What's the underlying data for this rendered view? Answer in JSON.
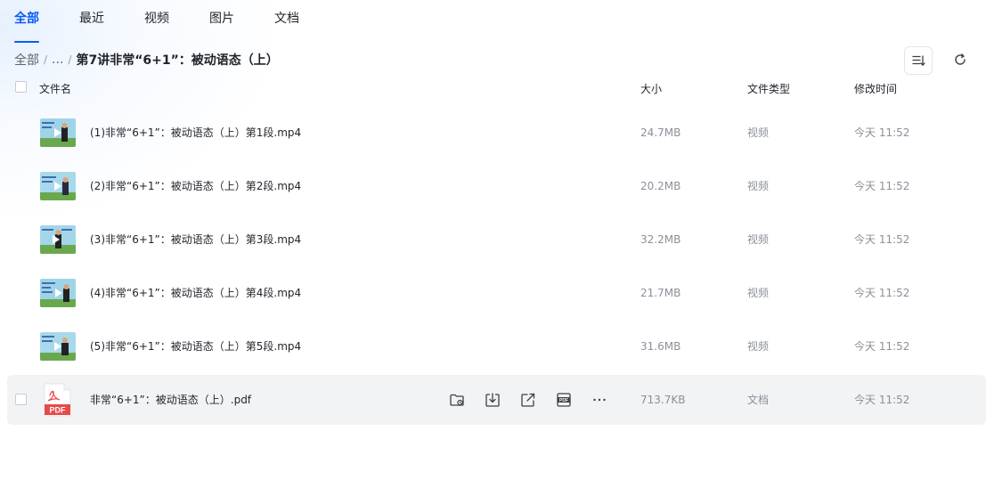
{
  "tabs": [
    {
      "label": "全部",
      "active": true
    },
    {
      "label": "最近",
      "active": false
    },
    {
      "label": "视频",
      "active": false
    },
    {
      "label": "图片",
      "active": false
    },
    {
      "label": "文档",
      "active": false
    }
  ],
  "breadcrumb": {
    "root": "全部",
    "separator": "/",
    "ellipsis": "...",
    "current": "第7讲非常“6+1”：被动语态（上）"
  },
  "toolbar": {
    "sort_icon": "sort-list-icon",
    "refresh_icon": "refresh-icon"
  },
  "table": {
    "headers": {
      "name": "文件名",
      "size": "大小",
      "type": "文件类型",
      "modified": "修改时间"
    },
    "rows": [
      {
        "name": "(1)非常“6+1”：被动语态（上）第1段.mp4",
        "size": "24.7MB",
        "type": "视频",
        "modified": "今天 11:52",
        "kind": "video"
      },
      {
        "name": "(2)非常“6+1”：被动语态（上）第2段.mp4",
        "size": "20.2MB",
        "type": "视频",
        "modified": "今天 11:52",
        "kind": "video"
      },
      {
        "name": "(3)非常“6+1”：被动语态（上）第3段.mp4",
        "size": "32.2MB",
        "type": "视频",
        "modified": "今天 11:52",
        "kind": "video"
      },
      {
        "name": "(4)非常“6+1”：被动语态（上）第4段.mp4",
        "size": "21.7MB",
        "type": "视频",
        "modified": "今天 11:52",
        "kind": "video"
      },
      {
        "name": "(5)非常“6+1”：被动语态（上）第5段.mp4",
        "size": "31.6MB",
        "type": "视频",
        "modified": "今天 11:52",
        "kind": "video"
      },
      {
        "name": "非常“6+1”：被动语态（上）.pdf",
        "size": "713.7KB",
        "type": "文档",
        "modified": "今天 11:52",
        "kind": "pdf",
        "hover": true
      }
    ],
    "hover_actions": [
      "move-to-folder-icon",
      "download-icon",
      "share-icon",
      "pdf-tool-icon",
      "more-icon"
    ]
  },
  "pdf_icon_label": "PDF",
  "colors": {
    "accent": "#0a59f7",
    "text_primary": "#1f2329",
    "text_secondary": "#8a9099",
    "row_hover": "#f2f3f5",
    "pdf_red": "#e84a4a"
  }
}
